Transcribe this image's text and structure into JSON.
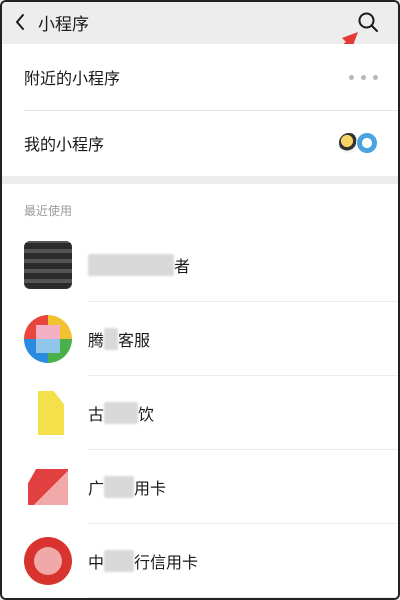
{
  "header": {
    "title": "小程序",
    "back_icon": "chevron-left-icon",
    "search_icon": "search-icon"
  },
  "top_entries": [
    {
      "label": "附近的小程序",
      "trailing": "more-dots-icon"
    },
    {
      "label": "我的小程序",
      "trailing": "mini-program-avatars"
    }
  ],
  "recent": {
    "section_label": "最近使用",
    "items": [
      {
        "name_suffix": "者"
      },
      {
        "name_prefix": "腾",
        "name_suffix": "客服"
      },
      {
        "name_prefix": "古",
        "name_suffix": "饮"
      },
      {
        "name_prefix": "广",
        "name_suffix": "用卡"
      },
      {
        "name_prefix": "中",
        "name_suffix": "行信用卡"
      }
    ]
  },
  "colors": {
    "background": "#ededed",
    "annotation_arrow": "#e53935"
  }
}
